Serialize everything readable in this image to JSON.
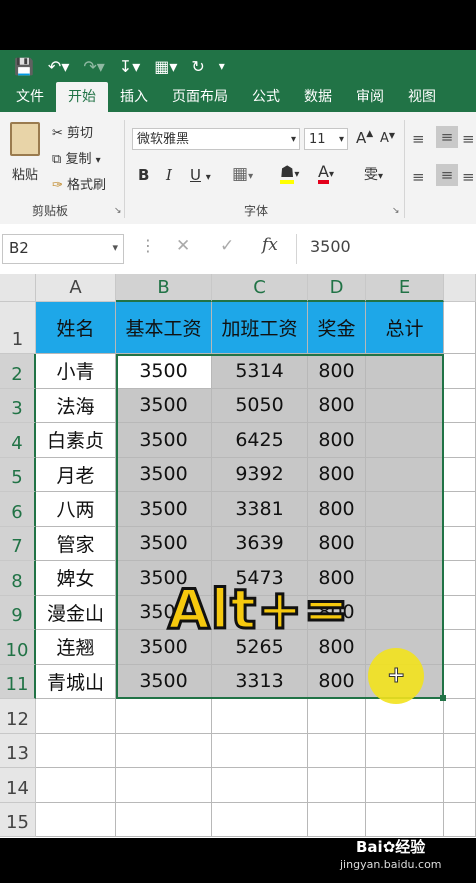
{
  "qat": {
    "save_icon": "save-icon",
    "undo_icon": "undo-icon",
    "redo_icon": "redo-icon"
  },
  "tabs": [
    "文件",
    "开始",
    "插入",
    "页面布局",
    "公式",
    "数据",
    "审阅",
    "视图"
  ],
  "ribbon": {
    "paste_label": "粘贴",
    "cut_label": "剪切",
    "copy_label": "复制",
    "format_painter_label": "格式刷",
    "clipboard_group": "剪贴板",
    "font_name": "微软雅黑",
    "font_size": "11",
    "font_group": "字体",
    "bold": "B",
    "italic": "I",
    "underline": "U",
    "grow_font": "A",
    "shrink_font": "A",
    "phonetic": "雯"
  },
  "formula_bar": {
    "name_box": "B2",
    "cancel": "✕",
    "enter": "✓",
    "fx": "fx",
    "value": "3500"
  },
  "columns": [
    "A",
    "B",
    "C",
    "D",
    "E"
  ],
  "rows": [
    "1",
    "2",
    "3",
    "4",
    "5",
    "6",
    "7",
    "8",
    "9",
    "10",
    "11",
    "12",
    "13",
    "14",
    "15"
  ],
  "table": {
    "headers": [
      "姓名",
      "基本工资",
      "加班工资",
      "奖金",
      "总计"
    ],
    "data": [
      [
        "小青",
        "3500",
        "5314",
        "800",
        ""
      ],
      [
        "法海",
        "3500",
        "5050",
        "800",
        ""
      ],
      [
        "白素贞",
        "3500",
        "6425",
        "800",
        ""
      ],
      [
        "月老",
        "3500",
        "9392",
        "800",
        ""
      ],
      [
        "八两",
        "3500",
        "3381",
        "800",
        ""
      ],
      [
        "管家",
        "3500",
        "3639",
        "800",
        ""
      ],
      [
        "婢女",
        "3500",
        "5473",
        "800",
        ""
      ],
      [
        "漫金山",
        "3500",
        "",
        "800",
        ""
      ],
      [
        "连翘",
        "3500",
        "5265",
        "800",
        ""
      ],
      [
        "青城山",
        "3500",
        "3313",
        "800",
        ""
      ]
    ]
  },
  "overlay": {
    "text": "Alt+="
  },
  "watermark": {
    "brand": "Bai",
    "brand2": "经验",
    "url": "jingyan.baidu.com"
  },
  "colors": {
    "excel_green": "#217346",
    "header_blue": "#1ea7e8",
    "selection_gray": "#c7c7c7",
    "cursor_yellow": "#f2e21d"
  }
}
